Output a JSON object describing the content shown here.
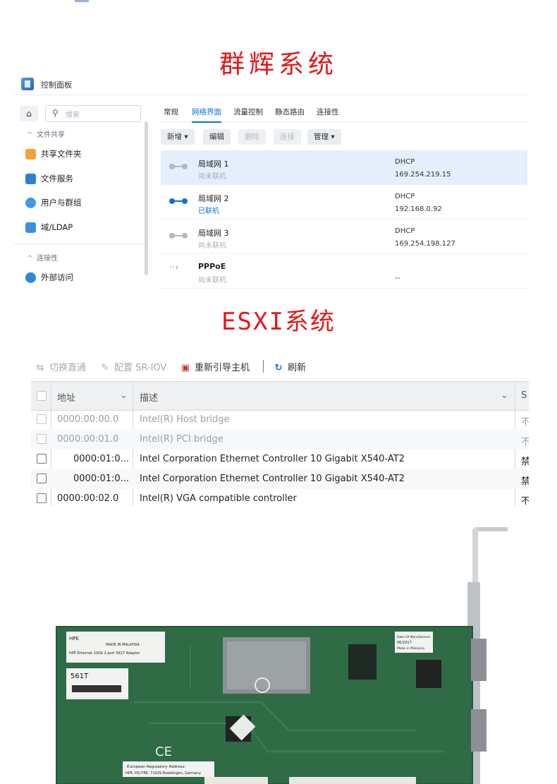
{
  "headings": {
    "synology": "群辉系统",
    "esxi": "ESXI系统"
  },
  "dsm": {
    "app_title": "控制面板",
    "search_placeholder": "搜索",
    "sidebar": {
      "section_file_sharing": "文件共享",
      "items": [
        {
          "label": "共享文件夹",
          "icon": "shared-folder-icon"
        },
        {
          "label": "文件服务",
          "icon": "file-services-icon"
        },
        {
          "label": "用户与群组",
          "icon": "users-groups-icon"
        },
        {
          "label": "域/LDAP",
          "icon": "domain-ldap-icon"
        }
      ],
      "section_connectivity": "连接性",
      "item_external": {
        "label": "外部访问",
        "icon": "external-access-icon"
      }
    },
    "tabs": [
      "常规",
      "网络界面",
      "流量控制",
      "静态路由",
      "连接性"
    ],
    "active_tab": "网络界面",
    "buttons": {
      "create": "新增",
      "edit": "编辑",
      "delete": "删除",
      "connect": "连接",
      "manage": "管理"
    },
    "interfaces": [
      {
        "name": "局域网 1",
        "status": "尚未联机",
        "protocol": "DHCP",
        "ip": "169.254.219.15"
      },
      {
        "name": "局域网 2",
        "status": "已联机",
        "protocol": "DHCP",
        "ip": "192.168.0.92"
      },
      {
        "name": "局域网 3",
        "status": "尚未联机",
        "protocol": "DHCP",
        "ip": "169.254.198.127"
      },
      {
        "name": "PPPoE",
        "status": "尚未联机",
        "protocol": "",
        "ip": "--"
      }
    ],
    "colors": {
      "accent": "#0b73d6",
      "selected_row": "#e4effb"
    }
  },
  "esxi": {
    "toolbar": {
      "toggle_passthrough": "切换直通",
      "configure_sriov": "配置 SR-IOV",
      "reboot_host": "重新引导主机",
      "refresh": "刷新"
    },
    "columns": {
      "address": "地址",
      "description": "描述",
      "status_partial": "S"
    },
    "rows": [
      {
        "address": "0000:00:00.0",
        "description": "Intel(R) Host bridge",
        "status": "不"
      },
      {
        "address": "0000:00:01.0",
        "description": "Intel(R) PCI bridge",
        "status": "不"
      },
      {
        "address": "0000:01:0...",
        "description": "Intel Corporation Ethernet Controller 10 Gigabit X540-AT2",
        "status": "禁"
      },
      {
        "address": "0000:01:0...",
        "description": "Intel Corporation Ethernet Controller 10 Gigabit X540-AT2",
        "status": "禁"
      },
      {
        "address": "0000:00:02.0",
        "description": "Intel(R) VGA compatible controller",
        "status": "不"
      }
    ]
  },
  "photo": {
    "brand": "HPE",
    "model": "561T",
    "label_line": "HPE Ethernet 10Gb 2-port 561T Adapter",
    "made_in": "MADE IN MALAYSIA",
    "date_label": "Date Of Manufacture",
    "date_value": "06/2017",
    "date_origin": "Made in Malaysia",
    "regulatory_1": "European Regulatory Address:",
    "regulatory_2": "HPE, HQ-TRE, 71029 Boeblingen, Germany"
  }
}
